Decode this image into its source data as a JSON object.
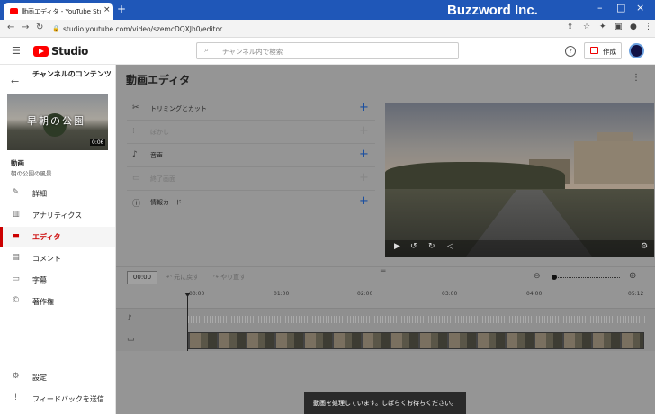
{
  "browser": {
    "tab_title": "動画エディタ - YouTube Studio",
    "new_tab": "+",
    "brand_overlay": "Buzzword Inc.",
    "url": "studio.youtube.com/video/szemcDQXJh0/editor"
  },
  "header": {
    "logo_text": "Studio",
    "search_placeholder": "チャンネル内で検索",
    "help": "?",
    "create_label": "作成"
  },
  "sidebar": {
    "title": "チャンネルのコンテンツ",
    "thumb_text": "早朝の公園",
    "thumb_duration": "0:06",
    "video_label": "動画",
    "video_name": "朝の公園の風景",
    "items": [
      {
        "label": "詳細",
        "icon": "pencil-icon"
      },
      {
        "label": "アナリティクス",
        "icon": "analytics-icon"
      },
      {
        "label": "エディタ",
        "icon": "editor-icon",
        "active": true
      },
      {
        "label": "コメント",
        "icon": "comment-icon"
      },
      {
        "label": "字幕",
        "icon": "subtitles-icon"
      },
      {
        "label": "著作権",
        "icon": "copyright-icon"
      }
    ],
    "settings": "設定",
    "feedback": "フィードバックを送信"
  },
  "editor": {
    "title": "動画エディタ",
    "tools": [
      {
        "label": "トリミングとカット",
        "icon": "scissors-icon",
        "enabled": true
      },
      {
        "label": "ぼかし",
        "icon": "blur-icon",
        "enabled": false
      },
      {
        "label": "音声",
        "icon": "music-icon",
        "enabled": true
      },
      {
        "label": "終了画面",
        "icon": "endscreen-icon",
        "enabled": false
      },
      {
        "label": "情報カード",
        "icon": "info-icon",
        "enabled": true
      }
    ],
    "add_symbol": "+"
  },
  "timeline": {
    "timecode": "00:00",
    "undo": "元に戻す",
    "redo": "やり直す",
    "ticks": [
      "00:00",
      "01:00",
      "02:00",
      "03:00",
      "04:00",
      "05:12"
    ]
  },
  "toast": "動画を処理しています。しばらくお待ちください。",
  "colors": {
    "brand_red": "#ff0000",
    "accent_blue": "#1a4fa0",
    "tab_bar": "#1f57b8"
  }
}
